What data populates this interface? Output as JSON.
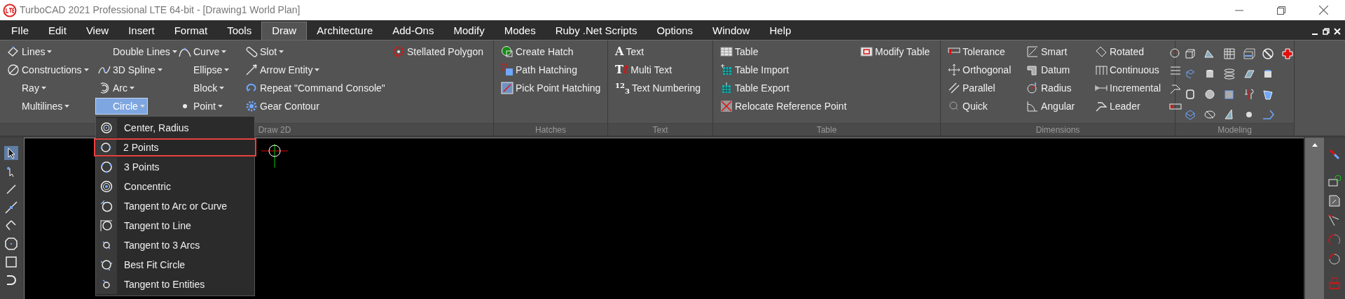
{
  "window": {
    "title": "TurboCAD 2021 Professional LTE 64-bit - [Drawing1 World Plan]"
  },
  "menu": [
    {
      "label": "FIle",
      "selected": false
    },
    {
      "label": "Edit",
      "selected": false
    },
    {
      "label": "View",
      "selected": false
    },
    {
      "label": "Insert",
      "selected": false
    },
    {
      "label": "Format",
      "selected": false
    },
    {
      "label": "Tools",
      "selected": false
    },
    {
      "label": "Draw",
      "selected": true
    },
    {
      "label": "Architecture",
      "selected": false
    },
    {
      "label": "Add-Ons",
      "selected": false
    },
    {
      "label": "Modify",
      "selected": false
    },
    {
      "label": "Modes",
      "selected": false
    },
    {
      "label": "Ruby .Net Scripts",
      "selected": false
    },
    {
      "label": "Options",
      "selected": false
    },
    {
      "label": "Window",
      "selected": false
    },
    {
      "label": "Help",
      "selected": false
    }
  ],
  "ribbon": [
    {
      "label": "Draw 2D",
      "columns": [
        [
          {
            "label": "Lines",
            "dropdown": true,
            "selected": false
          },
          {
            "label": "Constructions",
            "dropdown": true,
            "selected": false
          },
          {
            "label": "Ray",
            "dropdown": true,
            "selected": false
          },
          {
            "label": "Multilines",
            "dropdown": true,
            "selected": false
          }
        ],
        [
          {
            "label": "Double Lines",
            "dropdown": true,
            "selected": false
          },
          {
            "label": "3D Spline",
            "dropdown": true,
            "selected": false
          },
          {
            "label": "Arc",
            "dropdown": true,
            "selected": false
          },
          {
            "label": "Circle",
            "dropdown": true,
            "selected": true
          }
        ],
        [
          {
            "label": "Curve",
            "dropdown": true,
            "selected": false
          },
          {
            "label": "Ellipse",
            "dropdown": true,
            "selected": false
          },
          {
            "label": "Block",
            "dropdown": true,
            "selected": false
          },
          {
            "label": "Point",
            "dropdown": true,
            "selected": false
          }
        ],
        [
          {
            "label": "Slot",
            "dropdown": true,
            "selected": false
          },
          {
            "label": "Arrow Entity",
            "dropdown": true,
            "selected": false
          },
          {
            "label": "Repeat \"Command Console\"",
            "dropdown": false,
            "selected": false
          },
          {
            "label": "Gear Contour",
            "dropdown": false,
            "selected": false
          }
        ],
        [
          {
            "label": "Stellated Polygon",
            "dropdown": false,
            "selected": false
          }
        ]
      ]
    },
    {
      "label": "Hatches",
      "columns": [
        [
          {
            "label": "Create Hatch",
            "dropdown": false,
            "selected": false
          },
          {
            "label": "Path Hatching",
            "dropdown": false,
            "selected": false
          },
          {
            "label": "Pick Point Hatching",
            "dropdown": false,
            "selected": false
          }
        ]
      ]
    },
    {
      "label": "Text",
      "columns": [
        [
          {
            "label": "Text",
            "glyph": "A",
            "dropdown": false,
            "selected": false
          },
          {
            "label": "Multi Text",
            "glyph": "T",
            "glyph_accent": "t",
            "dropdown": false,
            "selected": false
          },
          {
            "label": "Text Numbering",
            "glyph": "$^{1}$$^{2}$$_{3}$",
            "dropdown": false,
            "selected": false
          }
        ]
      ]
    },
    {
      "label": "Table",
      "columns": [
        [
          {
            "label": "Table",
            "dropdown": false,
            "selected": false
          },
          {
            "label": "Table Import",
            "dropdown": false,
            "selected": false
          },
          {
            "label": "Table Export",
            "dropdown": false,
            "selected": false
          },
          {
            "label": "Relocate Reference Point",
            "dropdown": false,
            "selected": false
          }
        ],
        [
          {
            "label": "Modify Table",
            "dropdown": false,
            "selected": false
          }
        ]
      ]
    },
    {
      "label": "Dimensions",
      "columns": [
        [
          {
            "label": "Tolerance",
            "dropdown": false,
            "selected": false
          },
          {
            "label": "Orthogonal",
            "dropdown": false,
            "selected": false
          },
          {
            "label": "Parallel",
            "dropdown": false,
            "selected": false
          },
          {
            "label": "Quick",
            "dropdown": false,
            "selected": false
          }
        ],
        [
          {
            "label": "Smart",
            "dropdown": false,
            "selected": false
          },
          {
            "label": "Datum",
            "dropdown": false,
            "selected": false
          },
          {
            "label": "Radius",
            "dropdown": false,
            "selected": false
          },
          {
            "label": "Angular",
            "dropdown": false,
            "selected": false
          }
        ],
        [
          {
            "label": "Rotated",
            "dropdown": false,
            "selected": false
          },
          {
            "label": "Continuous",
            "dropdown": false,
            "selected": false
          },
          {
            "label": "Incremental",
            "dropdown": false,
            "selected": false
          },
          {
            "label": "Leader",
            "dropdown": false,
            "selected": false
          }
        ]
      ]
    },
    {
      "label": "Modeling"
    }
  ],
  "circle_menu": [
    {
      "label": "Center, Radius",
      "selected": false
    },
    {
      "label": "2 Points",
      "selected": true
    },
    {
      "label": "3 Points",
      "selected": false
    },
    {
      "label": "Concentric",
      "selected": false
    },
    {
      "label": "Tangent to Arc or Curve",
      "selected": false
    },
    {
      "label": "Tangent to Line",
      "selected": false
    },
    {
      "label": "Tangent to 3 Arcs",
      "selected": false
    },
    {
      "label": "Best Fit Circle",
      "selected": false
    },
    {
      "label": "Tangent to Entities",
      "selected": false
    }
  ]
}
